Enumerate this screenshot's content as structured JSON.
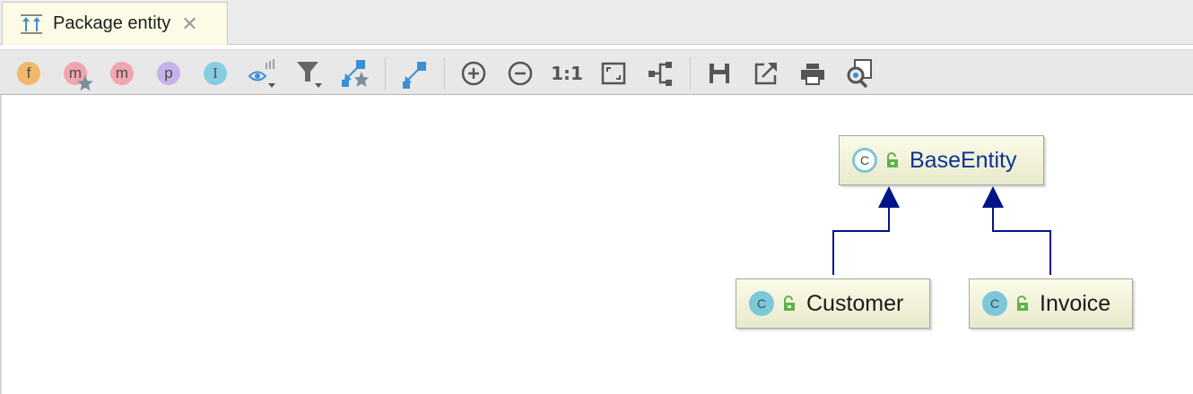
{
  "tab": {
    "title": "Package entity",
    "close_glyph": "✕",
    "icon": "diagram-icon"
  },
  "toolbar": {
    "fields_letter": "f",
    "methods_letter": "m",
    "constructors_letter": "m",
    "properties_letter": "p",
    "inner_classes_letter": "I",
    "actual_size_label": "1:1",
    "icons": [
      "show-fields-icon",
      "show-constructors-icon",
      "show-methods-icon",
      "show-properties-icon",
      "show-inner-classes-icon",
      "change-visibility-level-icon",
      "filter-icon",
      "show-dependencies-icon",
      "show-edge-labels-icon",
      "zoom-in-icon",
      "zoom-out-icon",
      "actual-size-icon",
      "fit-content-icon",
      "layout-icon",
      "save-icon",
      "export-icon",
      "print-icon",
      "print-preview-icon"
    ]
  },
  "diagram": {
    "nodes": [
      {
        "name": "BaseEntity",
        "kind": "C",
        "abstract": true
      },
      {
        "name": "Customer",
        "kind": "C",
        "abstract": false
      },
      {
        "name": "Invoice",
        "kind": "C",
        "abstract": false
      }
    ],
    "edges": [
      {
        "from": "Customer",
        "to": "BaseEntity",
        "type": "inheritance"
      },
      {
        "from": "Invoice",
        "to": "BaseEntity",
        "type": "inheritance"
      }
    ]
  },
  "colors": {
    "edge": "#00148a",
    "node_title_abstract": "#0a3393",
    "class_icon": "#7cc7d8",
    "public_lock": "#5fb346",
    "toolbar_icon_blue": "#3a8fd6",
    "fields_badge": "#f0b96c",
    "methods_badge": "#f0a6ad",
    "properties_badge": "#c7b2ec",
    "inner_badge": "#86cde4"
  }
}
